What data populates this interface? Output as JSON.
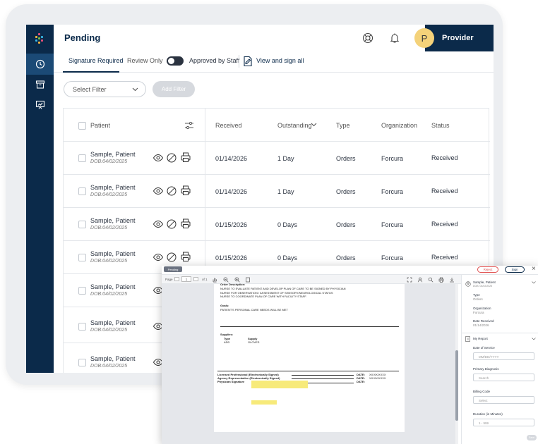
{
  "app": {
    "title": "Pending",
    "user_initial": "P",
    "user_label": "Provider"
  },
  "sidebar": {
    "items": [
      {
        "name": "history"
      },
      {
        "name": "archive"
      },
      {
        "name": "presentation"
      }
    ]
  },
  "tabs": {
    "signature_required": "Signature Required",
    "review_only": "Review Only",
    "approved_by_staff": "Approved by Staff",
    "view_and_sign_all": "View and sign all"
  },
  "filters": {
    "select_placeholder": "Select Filter",
    "add_filter": "Add Filter"
  },
  "table": {
    "headers": {
      "patient": "Patient",
      "received": "Received",
      "outstanding": "Outstanding",
      "type": "Type",
      "organization": "Organization",
      "status": "Status"
    },
    "rows": [
      {
        "name": "Sample, Patient",
        "dob": "DOB:04/02/2025",
        "received": "01/14/2026",
        "outstanding": "1 Day",
        "type": "Orders",
        "organization": "Forcura",
        "status": "Received"
      },
      {
        "name": "Sample, Patient",
        "dob": "DOB:04/02/2025",
        "received": "01/14/2026",
        "outstanding": "1 Day",
        "type": "Orders",
        "organization": "Forcura",
        "status": "Received"
      },
      {
        "name": "Sample, Patient",
        "dob": "DOB:04/02/2025",
        "received": "01/15/2026",
        "outstanding": "0 Days",
        "type": "Orders",
        "organization": "Forcura",
        "status": "Received"
      },
      {
        "name": "Sample, Patient",
        "dob": "DOB:04/02/2025",
        "received": "01/15/2026",
        "outstanding": "0 Days",
        "type": "Orders",
        "organization": "Forcura",
        "status": "Received"
      },
      {
        "name": "Sample, Patient",
        "dob": "DOB:04/02/2025"
      },
      {
        "name": "Sample, Patient",
        "dob": "DOB:04/02/2025"
      },
      {
        "name": "Sample, Patient",
        "dob": "DOB:04/02/2025"
      }
    ]
  },
  "viewer": {
    "status_chip": "Pending",
    "reject": "Reject",
    "sign": "Sign",
    "close": "×",
    "pdf": {
      "page_label": "Page",
      "page_num": "1",
      "page_of": "of 1",
      "order_description": "Order Description:",
      "order_lines": [
        "NURSE TO EVALUATE PATIENT AND DEVELOP PLAN OF CARE TO BE SIGNED BY PHYSICIAN",
        "NURSE FOR  OBSERVATION / ASSESSMENT OF SENSORY/NEUROLOGICAL STATUS",
        "NURSE TO COORDINATE PLAN OF CARE WITH FACILITY STAFF."
      ],
      "goals_label": "Goals:",
      "goals_text": "PATIENT'S PERSONAL CARE NEEDS WILL BE MET",
      "supplies_label": "Supplies:",
      "supplies_type_h": "Type",
      "supplies_supply_h": "Supply",
      "supplies_type": "ADD",
      "supplies_supply": "GLOVES",
      "sig_licensed": "Licensed Professional (Electronically Signed)",
      "sig_agency": "Agency Representative (Electronically Signed)",
      "sig_physician": "Physician Signature",
      "date_label": "DATE:",
      "date_value": "XX/XX/XXXX"
    },
    "panel": {
      "patient_name": "Sample, Patient",
      "patient_dob": "DOB: 04/02/2025",
      "type_label": "Type",
      "type_value": "Orders",
      "org_label": "Organization",
      "org_value": "Forcura",
      "date_received_label": "Date Received",
      "date_received_value": "01/14/2026",
      "my_report": "My Report",
      "date_of_service": "Date of Service",
      "date_placeholder": "MM/DD/YYYY",
      "primary_diagnosis": "Primary Diagnosis",
      "search_placeholder": "Search",
      "billing_code": "Billing Code",
      "select_placeholder": "Select",
      "duration_label": "Duration (in Minutes)",
      "duration_placeholder": "1 - 999",
      "done": "Save"
    }
  },
  "colors": {
    "navy": "#0b2a4a",
    "accent_yellow": "#f4d27a",
    "reject_red": "#e05252",
    "highlight": "#f7ea7a"
  }
}
